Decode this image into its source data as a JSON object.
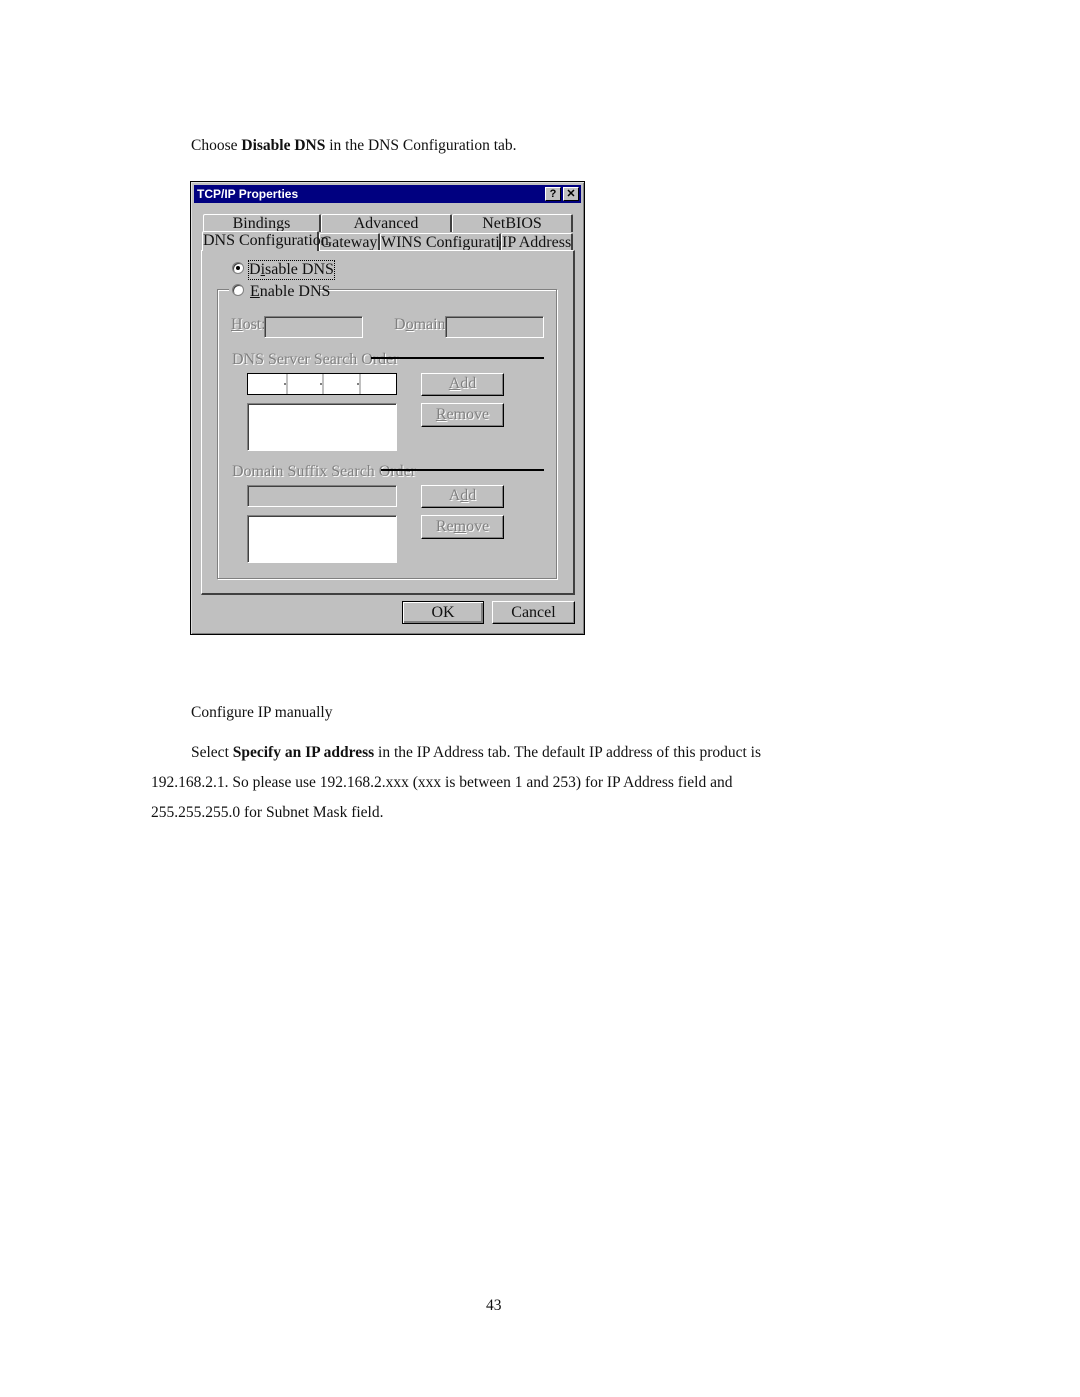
{
  "document": {
    "intro": {
      "prefix": "Choose ",
      "bold": "Disable DNS",
      "suffix": " in the DNS Configuration tab."
    },
    "section_heading": "Configure IP manually",
    "body": {
      "line1_prefix": "Select ",
      "line1_bold": "Specify an IP address",
      "line1_suffix": " in the IP Address tab. The default IP address of this product is",
      "line2": "192.168.2.1. So please use 192.168.2.xxx (xxx is between 1 and 253) for IP Address field and",
      "line3": "255.255.255.0 for Subnet Mask field."
    },
    "page_number": "43"
  },
  "dialog": {
    "title": "TCP/IP Properties",
    "help_button": "?",
    "close_button": "✕",
    "tabs_back": [
      "Bindings",
      "Advanced",
      "NetBIOS"
    ],
    "tabs_front": [
      "DNS Configuration",
      "Gateway",
      "WINS Configuration",
      "IP Address"
    ],
    "active_tab": "DNS Configuration",
    "disable_dns": {
      "label_pre": "D",
      "label_u": "i",
      "label_post": "sable DNS",
      "selected": true
    },
    "enable_dns": {
      "label_u": "E",
      "label_post": "nable DNS",
      "selected": false
    },
    "host_label_u": "H",
    "host_label_post": "ost:",
    "host_value": "",
    "domain_label_pre": "D",
    "domain_label_u": "o",
    "domain_label_post": "main:",
    "domain_value": "",
    "dns_server_order_label": "DNS Server Search Order",
    "dns_ip_value": "",
    "dns_add_u": "A",
    "dns_add_post": "dd",
    "dns_remove_u": "R",
    "dns_remove_post": "emove",
    "domain_suffix_label": "Domain Suffix Search Order",
    "suffix_value": "",
    "suffix_add_pre": "A",
    "suffix_add_u": "d",
    "suffix_add_post": "d",
    "suffix_remove_pre": "Re",
    "suffix_remove_u": "m",
    "suffix_remove_post": "ove",
    "ok_label": "OK",
    "cancel_label": "Cancel"
  }
}
